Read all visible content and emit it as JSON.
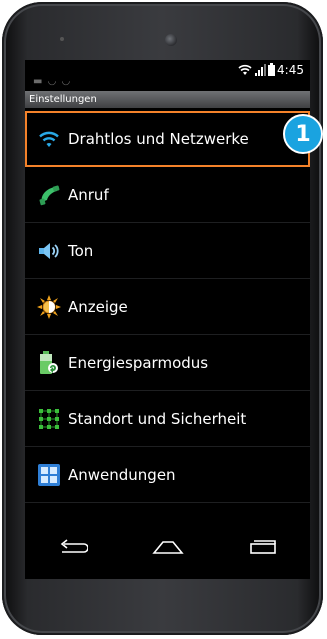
{
  "status_bar": {
    "time": "4:45",
    "icons": [
      "wifi-icon",
      "signal-icon",
      "battery-icon"
    ]
  },
  "app_title": "Einstellungen",
  "items": [
    {
      "label": "Drahtlos und Netzwerke",
      "icon": "wifi-icon",
      "selected": true
    },
    {
      "label": "Anruf",
      "icon": "phone-icon"
    },
    {
      "label": "Ton",
      "icon": "speaker-icon"
    },
    {
      "label": "Anzeige",
      "icon": "brightness-icon"
    },
    {
      "label": "Energiesparmodus",
      "icon": "battery-saver-icon"
    },
    {
      "label": "Standort und Sicherheit",
      "icon": "location-grid-icon"
    },
    {
      "label": "Anwendungen",
      "icon": "apps-icon"
    }
  ],
  "nav": [
    "back-icon",
    "home-icon",
    "recents-icon"
  ],
  "step_badge": "1",
  "colors": {
    "highlight": "#f4822a",
    "badge": "#1aa3e0",
    "wifi": "#29a9e6",
    "phone": "#3cc06a"
  }
}
